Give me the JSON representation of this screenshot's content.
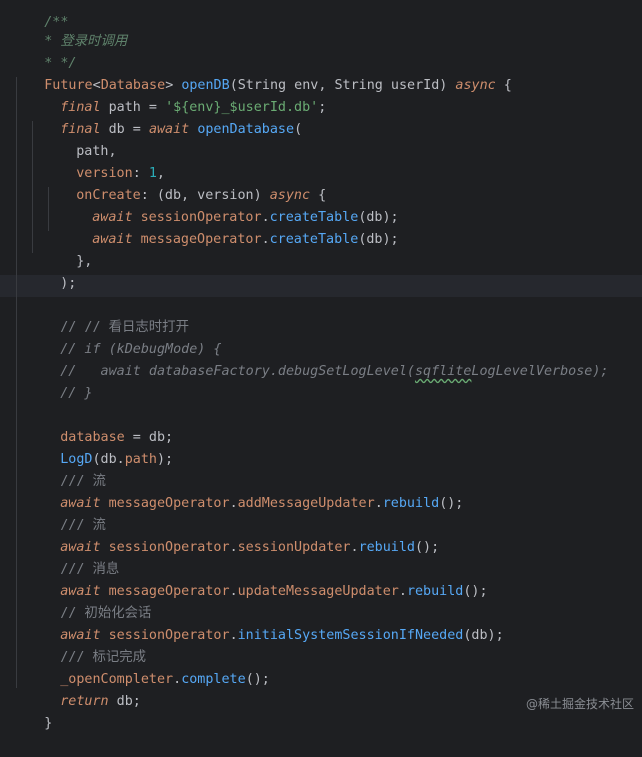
{
  "code": {
    "l0_comment_tail": "/**",
    "l1_doc": "* 登录时调用",
    "l2_doc_end": "* */",
    "l3": {
      "future": "Future",
      "lt": "<",
      "dbtype": "Database",
      "gt": ">",
      "name": "openDB",
      "p1": "(String env, String userId) ",
      "async": "async",
      "brace": " {"
    },
    "l4": {
      "final": "final",
      "rest1": " path = ",
      "str": "'${env}_$userId.db'",
      "semi": ";"
    },
    "l5": {
      "final": "final",
      "rest1": " db = ",
      "await": "await",
      "fn": "openDatabase",
      "paren": "("
    },
    "l6": "path,",
    "l7": {
      "param": "version",
      "colon": ": ",
      "num": "1",
      "comma": ","
    },
    "l8": {
      "param": "onCreate",
      "rest": ": (db, version) ",
      "async": "async",
      "brace": " {"
    },
    "l9": {
      "await": "await",
      "obj": "sessionOperator",
      "dot": ".",
      "fn": "createTable",
      "args": "(db);"
    },
    "l10": {
      "await": "await",
      "obj": "messageOperator",
      "dot": ".",
      "fn": "createTable",
      "args": "(db);"
    },
    "l11": "},",
    "l12": ");",
    "l14": "// // 看日志时打开",
    "l15": "// if (kDebugMode) {",
    "l16": {
      "prefix": "//   await databaseFactory.debugSetLogLevel(",
      "squig": "sqflite",
      "suffix": "LogLevelVerbose);"
    },
    "l17": "// }",
    "l19": {
      "fld": "database",
      "rest": " = db;"
    },
    "l20": {
      "fn": "LogD",
      "p": "(db.",
      "fld": "path",
      "end": ");"
    },
    "l21": "/// 流",
    "l22": {
      "await": "await",
      "obj": "messageOperator",
      "dot1": ".",
      "fld": "addMessageUpdater",
      "dot2": ".",
      "fn": "rebuild",
      "end": "();"
    },
    "l23": "/// 流",
    "l24": {
      "await": "await",
      "obj": "sessionOperator",
      "dot1": ".",
      "fld": "sessionUpdater",
      "dot2": ".",
      "fn": "rebuild",
      "end": "();"
    },
    "l25": "/// 消息",
    "l26": {
      "await": "await",
      "obj": "messageOperator",
      "dot1": ".",
      "fld": "updateMessageUpdater",
      "dot2": ".",
      "fn": "rebuild",
      "end": "();"
    },
    "l27": "// 初始化会话",
    "l28": {
      "await": "await",
      "obj": "sessionOperator",
      "dot": ".",
      "fn": "initialSystemSessionIfNeeded",
      "end": "(db);"
    },
    "l29": "/// 标记完成",
    "l30": {
      "fld": "_openCompleter",
      "dot": ".",
      "fn": "complete",
      "end": "();"
    },
    "l31": {
      "ret": "return",
      "rest": " db;"
    },
    "l32": "}"
  },
  "watermark": "@稀土掘金技术社区",
  "colors": {
    "background": "#1e1f22",
    "keyword": "#cf8e6d",
    "function": "#56a8f5",
    "string": "#6aab73",
    "number": "#2aacb8",
    "field": "#c77dbb",
    "comment": "#7a7e85",
    "doc_comment": "#5f826b"
  }
}
